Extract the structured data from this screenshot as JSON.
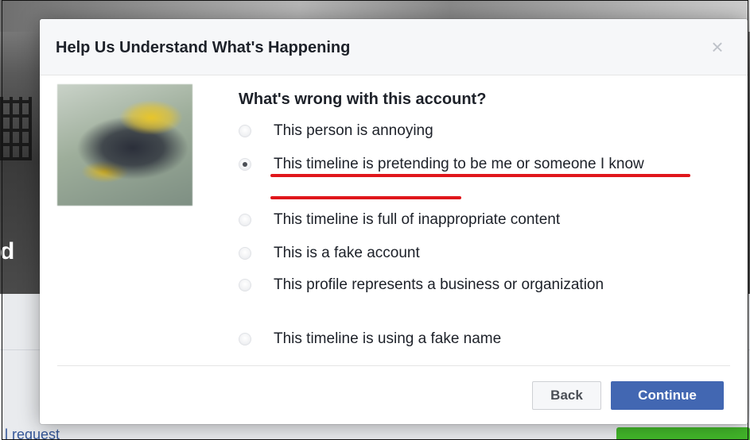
{
  "dialog": {
    "title": "Help Us Understand What's Happening",
    "close_icon": "close-icon",
    "question": "What's wrong with this account?",
    "options": [
      {
        "label": "This person is annoying",
        "selected": false
      },
      {
        "label": "This timeline is pretending to be me or someone I know",
        "selected": true
      },
      {
        "label": "This timeline is full of inappropriate content",
        "selected": false
      },
      {
        "label": "This is a fake account",
        "selected": false
      },
      {
        "label": "This profile represents a business or organization",
        "selected": false
      },
      {
        "label": "This timeline is using a fake name",
        "selected": false
      }
    ],
    "back_label": "Back",
    "continue_label": "Continue"
  },
  "background": {
    "footer_text": "l request"
  },
  "colors": {
    "primary_button": "#4267b2",
    "annotation_underline": "#e0161b",
    "text": "#1d2129"
  }
}
